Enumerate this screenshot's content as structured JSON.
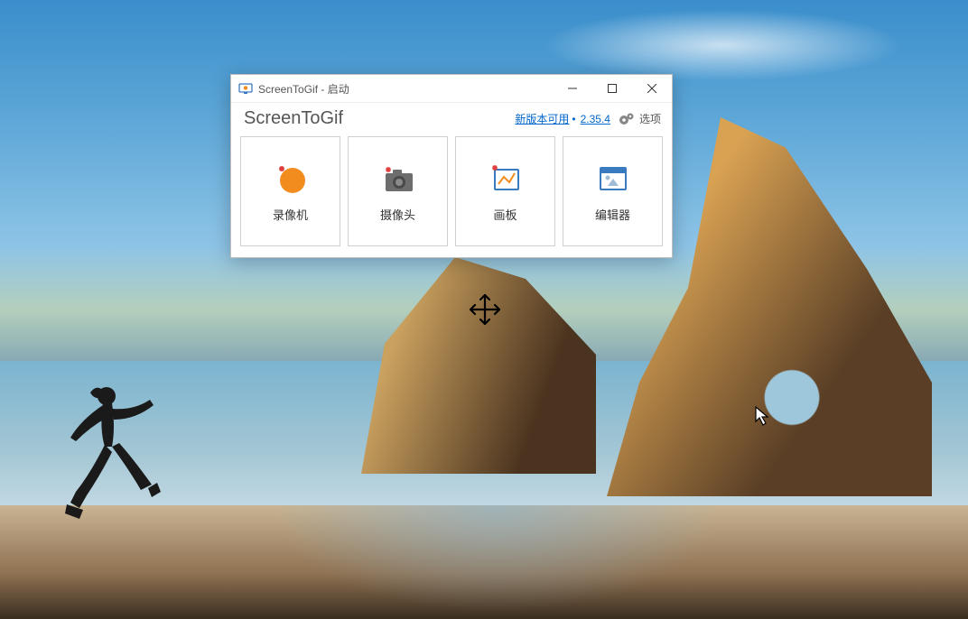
{
  "titlebar": {
    "title": "ScreenToGif - 启动"
  },
  "header": {
    "app_name": "ScreenToGif",
    "update_text": "新版本可用",
    "version": "2.35.4",
    "options_label": "选项"
  },
  "tiles": {
    "recorder": "录像机",
    "webcam": "摄像头",
    "board": "画板",
    "editor": "编辑器"
  }
}
